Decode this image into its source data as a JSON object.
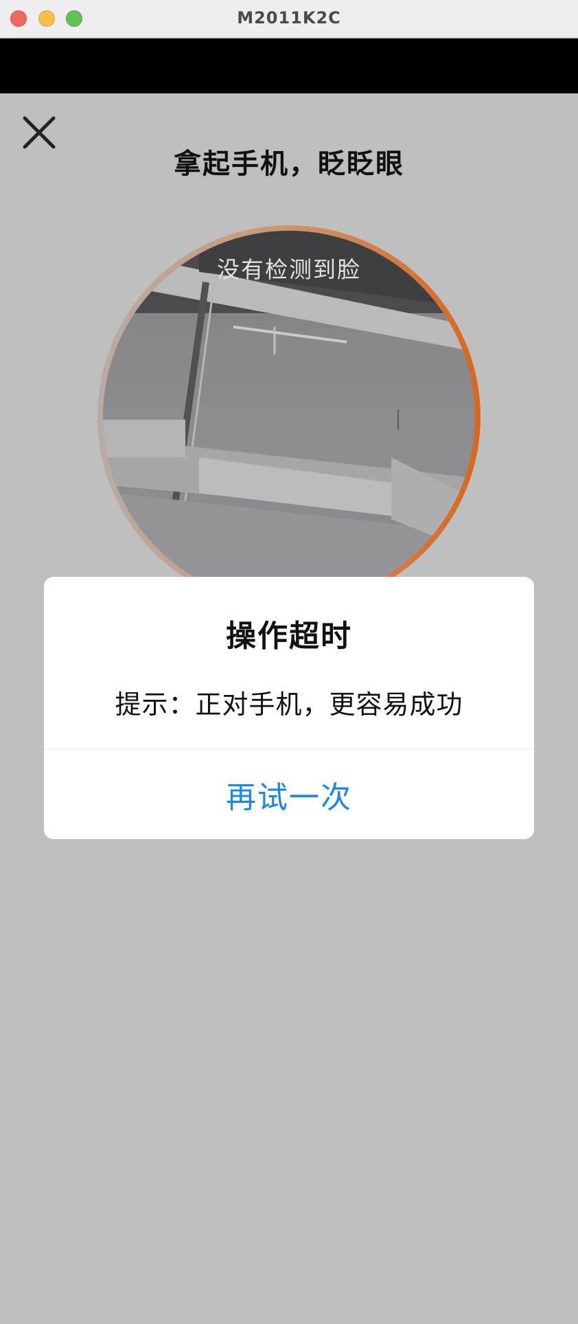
{
  "window": {
    "title": "M2011K2C"
  },
  "screen": {
    "prompt": "拿起手机，眨眨眼",
    "camera_status": "没有检测到脸"
  },
  "dialog": {
    "title": "操作超时",
    "message": "提示：正对手机，更容易成功",
    "retry_label": "再试一次"
  },
  "colors": {
    "accent": "#1b87e0",
    "ring_start": "#b9aba3",
    "ring_end": "#d9661e",
    "overlay": "#bfbfbf"
  },
  "icons": {
    "close": "close-icon"
  }
}
